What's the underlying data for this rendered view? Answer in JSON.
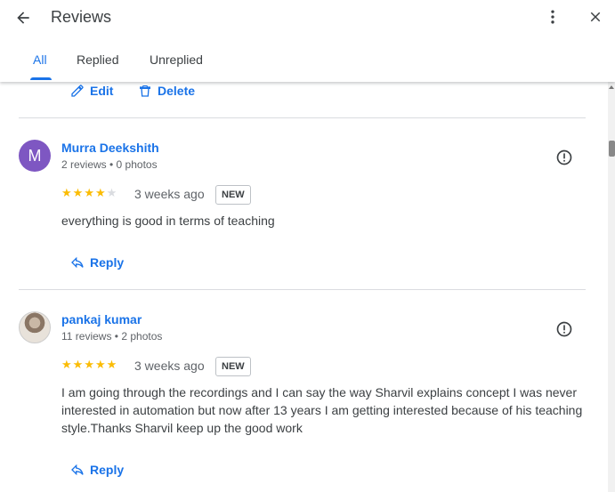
{
  "header": {
    "title": "Reviews",
    "icons": {
      "back": "arrow-back-icon",
      "more": "more-vert-icon",
      "close": "close-icon"
    }
  },
  "tabs": [
    {
      "label": "All",
      "active": true
    },
    {
      "label": "Replied",
      "active": false
    },
    {
      "label": "Unreplied",
      "active": false
    }
  ],
  "previous_review_actions": {
    "edit_label": "Edit",
    "delete_label": "Delete"
  },
  "reviews": [
    {
      "avatar_letter": "M",
      "name": "Murra Deekshith",
      "meta": "2 reviews • 0 photos",
      "rating": 4,
      "time": "3 weeks ago",
      "badge": "NEW",
      "text": "everything is good in terms of teaching",
      "reply_label": "Reply"
    },
    {
      "avatar_letter": "",
      "name": "pankaj kumar",
      "meta": "11 reviews • 2 photos",
      "rating": 5,
      "time": "3 weeks ago",
      "badge": "NEW",
      "text": "I am going through the recordings and I can say the way Sharvil explains concept I was never interested in automation but now after 13 years I am getting interested because of his teaching style.Thanks Sharvil keep up the good work",
      "reply_label": "Reply"
    }
  ],
  "colors": {
    "accent": "#1a73e8",
    "star": "#fbbc04",
    "avatar_purple": "#7e57c2"
  }
}
